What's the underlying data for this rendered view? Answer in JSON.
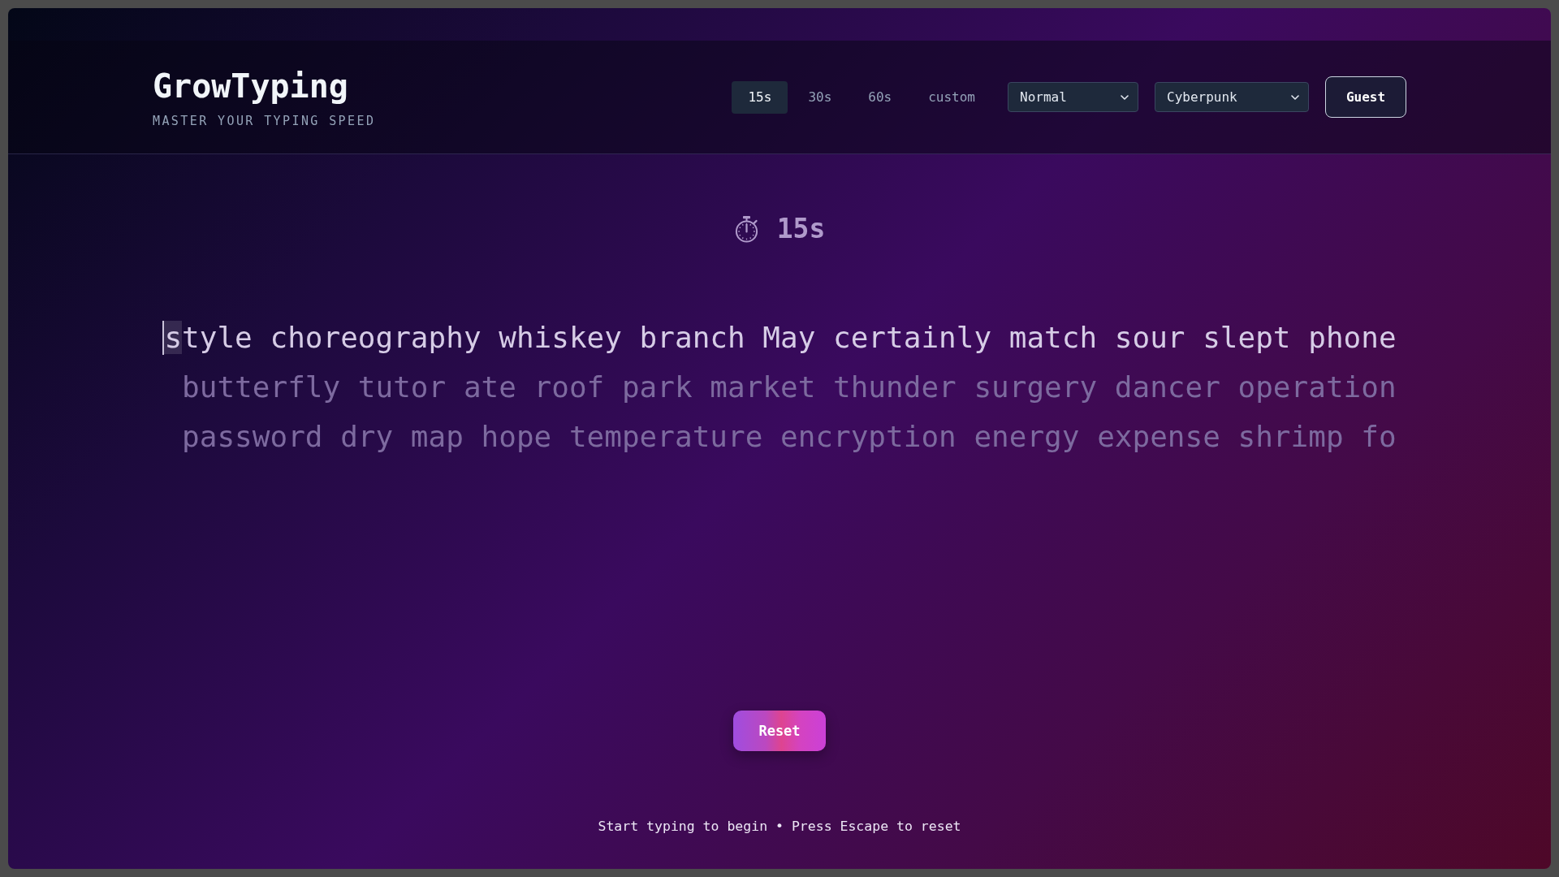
{
  "header": {
    "title": "GrowTyping",
    "tagline": "MASTER YOUR TYPING SPEED",
    "duration_tabs": [
      {
        "label": "15s",
        "selected": true
      },
      {
        "label": "30s",
        "selected": false
      },
      {
        "label": "60s",
        "selected": false
      },
      {
        "label": "custom",
        "selected": false
      }
    ],
    "difficulty_select": {
      "value": "Normal"
    },
    "theme_select": {
      "value": "Cyberpunk"
    },
    "account_button": {
      "label": "Guest"
    }
  },
  "timer": {
    "value": "15s"
  },
  "typing_text": {
    "lines": [
      {
        "cursor_char": "s",
        "text": "tyle choreography whiskey branch May certainly match sour slept phone",
        "active": true
      },
      {
        "text": "butterfly tutor ate roof park market thunder surgery dancer operation",
        "active": false
      },
      {
        "text": "password dry map hope temperature encryption energy expense shrimp fo",
        "active": false
      }
    ]
  },
  "reset_button": {
    "label": "Reset"
  },
  "hint": "Start typing to begin • Press Escape to reset"
}
